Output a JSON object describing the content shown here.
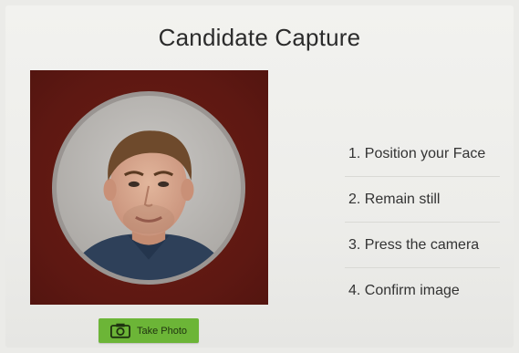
{
  "page": {
    "title": "Candidate Capture"
  },
  "camera": {
    "frame_color": "#5e1812",
    "ring_color": "#9a9592"
  },
  "capture_button": {
    "label": "Take Photo",
    "icon": "camera-icon",
    "color": "#6cb537"
  },
  "steps": [
    {
      "label": "1. Position your Face"
    },
    {
      "label": "2. Remain still"
    },
    {
      "label": "3. Press the camera"
    },
    {
      "label": "4. Confirm image"
    }
  ]
}
